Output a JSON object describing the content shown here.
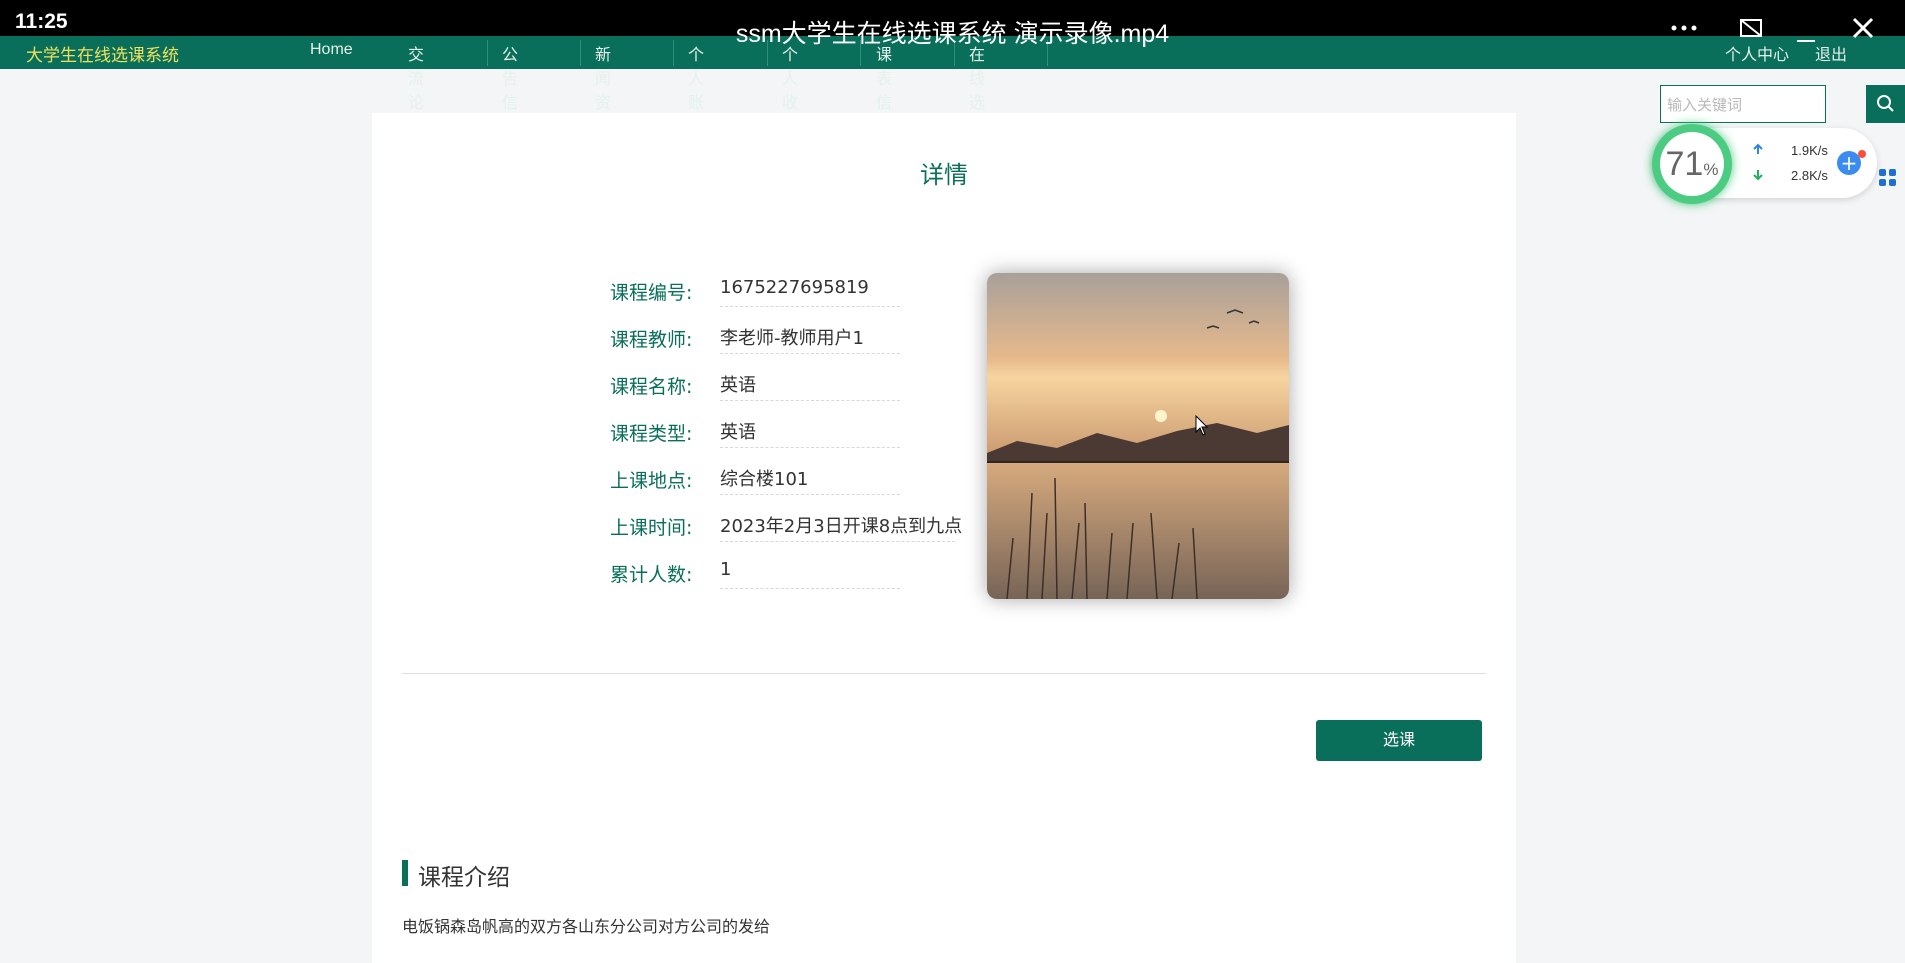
{
  "video": {
    "clock": "11:25",
    "title": "ssm大学生在线选课系统 演示录像.mp4",
    "more_icon": "more-horizontal-icon",
    "pip_icon": "picture-in-picture-icon",
    "minimize_icon": "minimize-icon",
    "close_icon": "close-icon"
  },
  "nav": {
    "brand": "大学生在线选课系统",
    "items": [
      {
        "label": "Home"
      },
      {
        "label": "交流论坛"
      },
      {
        "label": "公告信息"
      },
      {
        "label": "新闻资讯"
      },
      {
        "label": "个人账户"
      },
      {
        "label": "个人收藏"
      },
      {
        "label": "课表信息"
      },
      {
        "label": "在线选课"
      }
    ],
    "personal": "个人中心",
    "logout": "退出"
  },
  "search": {
    "placeholder": "输入关键词",
    "icon": "search-icon"
  },
  "network_widget": {
    "percent": "71",
    "percent_sign": "%",
    "upload": "1.9K/s",
    "download": "2.8K/s",
    "plus_icon": "plus-icon",
    "grid_icon": "apps-grid-icon"
  },
  "detail": {
    "title": "详情",
    "fields": [
      {
        "label": "课程编号:",
        "value": "1675227695819"
      },
      {
        "label": "课程教师:",
        "value": "李老师-教师用户1"
      },
      {
        "label": "课程名称:",
        "value": "英语"
      },
      {
        "label": "课程类型:",
        "value": "英语"
      },
      {
        "label": "上课地点:",
        "value": "综合楼101"
      },
      {
        "label": "上课时间:",
        "value": "2023年2月3日开课8点到九点"
      },
      {
        "label": "累计人数:",
        "value": "1"
      }
    ],
    "select_button": "选课",
    "section_title": "课程介绍",
    "intro": "电饭锅森岛帆高的双方各山东分公司对方公司的发给"
  },
  "colors": {
    "primary": "#0a6f5a",
    "brand_text": "#f1e05a",
    "accent_green": "#4ccb82"
  }
}
